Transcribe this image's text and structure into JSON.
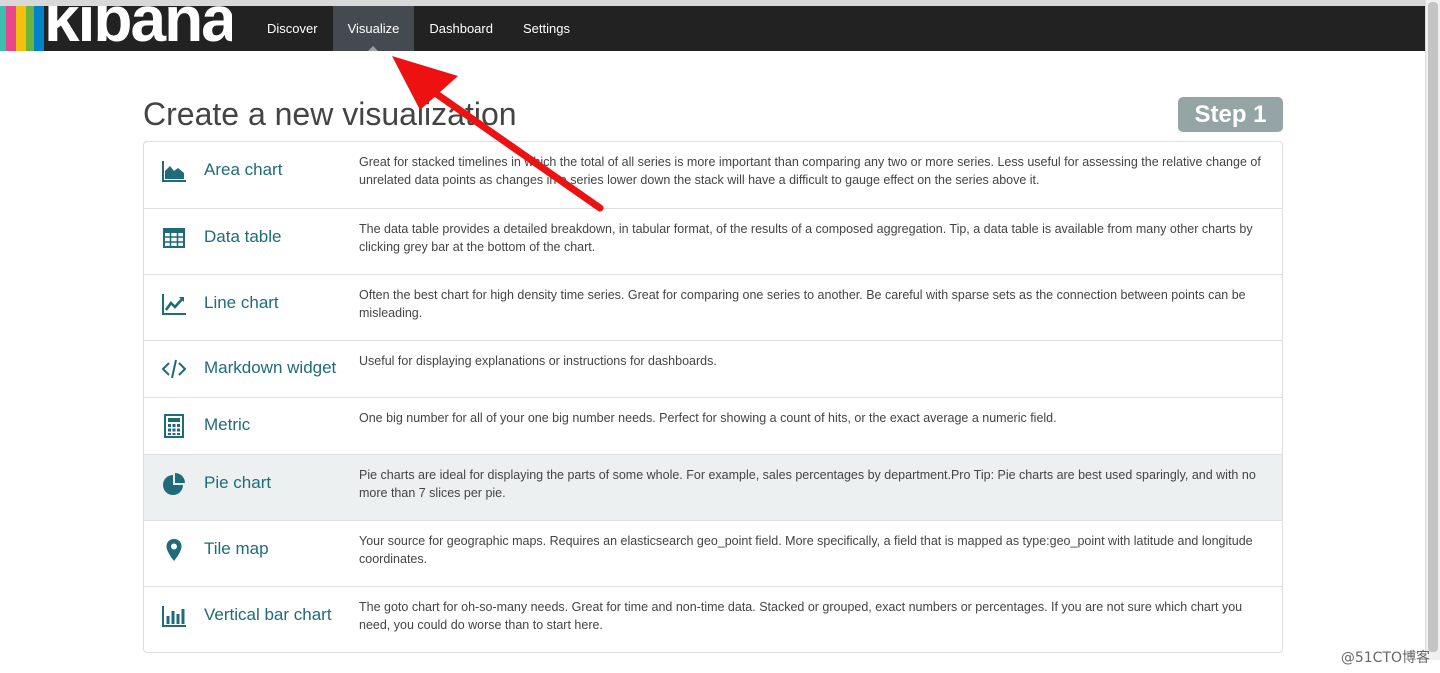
{
  "brand": {
    "logo_text": "kibana",
    "logo_bar_colors": [
      "#3ebeb0",
      "#e8488b",
      "#f2c10e",
      "#6db33f",
      "#0082c8"
    ]
  },
  "nav": {
    "tabs": [
      {
        "label": "Discover",
        "active": false
      },
      {
        "label": "Visualize",
        "active": true
      },
      {
        "label": "Dashboard",
        "active": false
      },
      {
        "label": "Settings",
        "active": false
      }
    ]
  },
  "main": {
    "title": "Create a new visualization",
    "step_label": "Step 1",
    "visualizations": [
      {
        "icon": "area-chart-icon",
        "name": "Area chart",
        "description": "Great for stacked timelines in which the total of all series is more important than comparing any two or more series. Less useful for assessing the relative change of unrelated data points as changes in a series lower down the stack will have a difficult to gauge effect on the series above it."
      },
      {
        "icon": "table-icon",
        "name": "Data table",
        "description": "The data table provides a detailed breakdown, in tabular format, of the results of a composed aggregation. Tip, a data table is available from many other charts by clicking grey bar at the bottom of the chart."
      },
      {
        "icon": "line-chart-icon",
        "name": "Line chart",
        "description": "Often the best chart for high density time series. Great for comparing one series to another. Be careful with sparse sets as the connection between points can be misleading."
      },
      {
        "icon": "code-icon",
        "name": "Markdown widget",
        "description": "Useful for displaying explanations or instructions for dashboards."
      },
      {
        "icon": "calculator-icon",
        "name": "Metric",
        "description": "One big number for all of your one big number needs. Perfect for showing a count of hits, or the exact average a numeric field."
      },
      {
        "icon": "pie-chart-icon",
        "name": "Pie chart",
        "description": "Pie charts are ideal for displaying the parts of some whole. For example, sales percentages by department.Pro Tip: Pie charts are best used sparingly, and with no more than 7 slices per pie.",
        "highlighted": true
      },
      {
        "icon": "map-marker-icon",
        "name": "Tile map",
        "description": "Your source for geographic maps. Requires an elasticsearch geo_point field. More specifically, a field that is mapped as type:geo_point with latitude and longitude coordinates."
      },
      {
        "icon": "bar-chart-icon",
        "name": "Vertical bar chart",
        "description": "The goto chart for oh-so-many needs. Great for time and non-time data. Stacked or grouped, exact numbers or percentages. If you are not sure which chart you need, you could do worse than to start here."
      }
    ]
  },
  "colors": {
    "navbar": "#222222",
    "active_tab": "#444a50",
    "link_teal": "#1f6b7a",
    "step_badge": "#95a5a6",
    "highlight_row": "#ecf0f1",
    "annotation_arrow": "#ee1111"
  },
  "watermark": "@51CTO博客"
}
